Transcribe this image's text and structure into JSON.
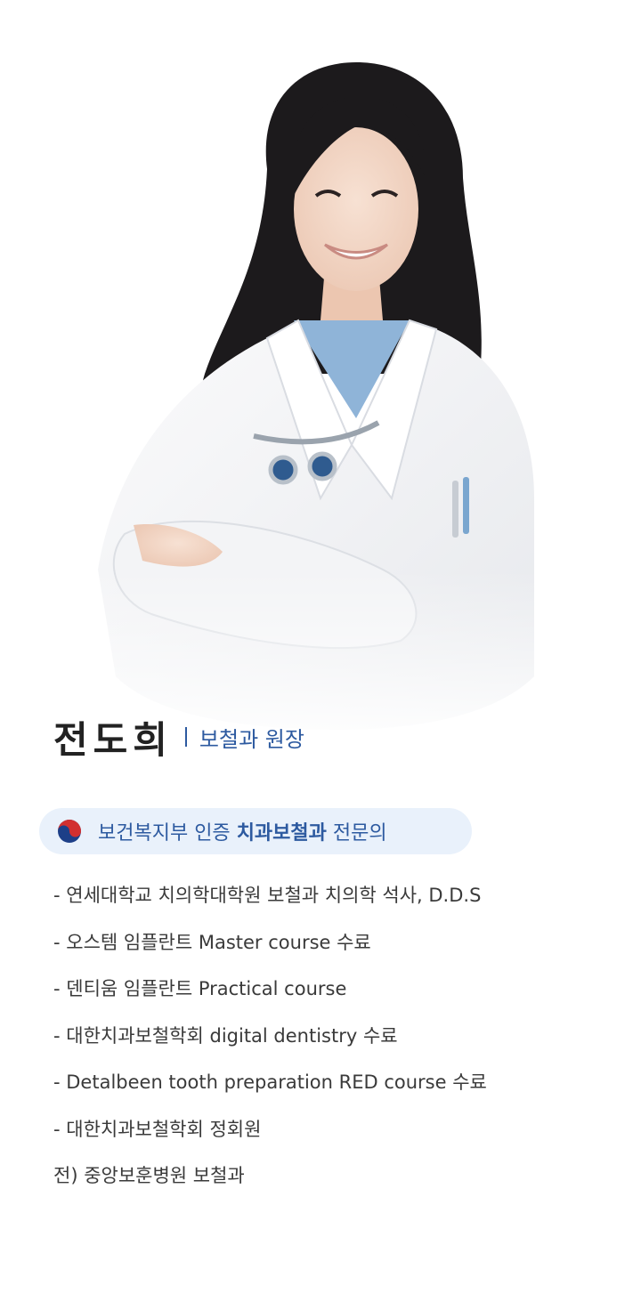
{
  "doctor": {
    "name": "전도희",
    "title": "보철과 원장"
  },
  "certification": {
    "prefix": "보건복지부 인증",
    "highlight": "치과보철과",
    "suffix": "전문의"
  },
  "career": [
    "- 연세대학교 치의학대학원 보철과 치의학 석사, D.D.S",
    "- 오스템 임플란트 Master course 수료",
    "- 덴티움 임플란트 Practical course",
    "- 대한치과보철학회 digital dentistry 수료",
    "- Detalbeen tooth preparation RED course 수료",
    "- 대한치과보철학회 정회원",
    "전) 중앙보훈병원 보철과"
  ],
  "colors": {
    "accent": "#2d5aa0",
    "pill_bg": "#e9f1fb",
    "name": "#222222",
    "body_text": "#3a3a3a"
  },
  "icons": {
    "cert": "taeguk-emblem-icon"
  }
}
